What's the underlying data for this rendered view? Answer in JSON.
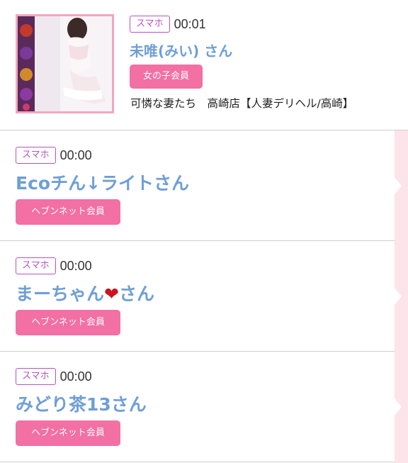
{
  "featured": {
    "device_tag": "スマホ",
    "time": "00:01",
    "name": "未唯(みい) さん",
    "member_label": "女の子会員",
    "shop": "可憐な妻たち　高崎店【人妻デリヘル/高崎】"
  },
  "rows": [
    {
      "device_tag": "スマホ",
      "time": "00:00",
      "name": "Ecoチん↓ライトさん",
      "member_label": "ヘブンネット会員"
    },
    {
      "device_tag": "スマホ",
      "time": "00:00",
      "name_before": "まーちゃん",
      "name_heart": "❤",
      "name_after": "さん",
      "member_label": "ヘブンネット会員"
    },
    {
      "device_tag": "スマホ",
      "time": "00:00",
      "name": "みどり茶13さん",
      "member_label": "ヘブンネット会員"
    }
  ],
  "colors": {
    "tag_purple": "#b654c0",
    "name_blue": "#6f9fd6",
    "member_pink": "#f270a3",
    "strip_pink": "#fde3ea"
  }
}
